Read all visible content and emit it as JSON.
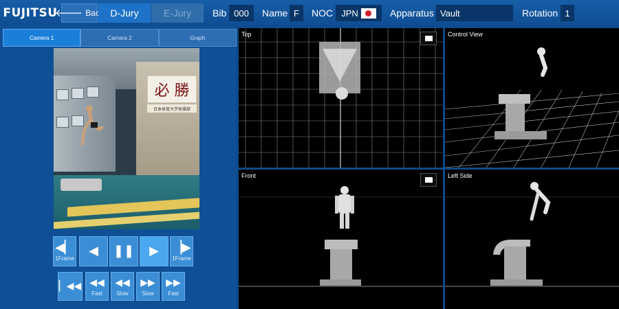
{
  "header": {
    "logo": "FUJITSU",
    "back_label": "Back",
    "d_jury_label": "D-Jury",
    "e_jury_label": "E-Jury",
    "bib_label": "Bib",
    "bib_value": "000",
    "name_label": "Name",
    "name_value": "F",
    "noc_label": "NOC",
    "noc_value": "JPN",
    "apparatus_label": "Apparatus",
    "apparatus_value": "Vault",
    "rotation_label": "Rotation",
    "rotation_value": "1"
  },
  "tabs": [
    {
      "label": "Camera 1",
      "active": true
    },
    {
      "label": "Camera 2",
      "active": false
    },
    {
      "label": "Graph",
      "active": false
    }
  ],
  "video": {
    "banner_text": "必 勝",
    "banner_sub": "日本体育大学体操部"
  },
  "controls": {
    "row1": [
      {
        "name": "prev-frame-button",
        "glyph": "◀▏",
        "sub": "1Frame"
      },
      {
        "name": "reverse-play-button",
        "glyph": "◀",
        "sub": ""
      },
      {
        "name": "pause-button",
        "glyph": "❚❚",
        "sub": ""
      },
      {
        "name": "play-button",
        "glyph": "▶",
        "sub": ""
      },
      {
        "name": "next-frame-button",
        "glyph": "▕▶",
        "sub": "1Frame"
      }
    ],
    "row2": [
      {
        "name": "skip-to-start-button",
        "glyph": "▏◀◀",
        "sub": ""
      },
      {
        "name": "fast-rewind-button",
        "glyph": "◀◀",
        "sub": "Fast"
      },
      {
        "name": "slow-rewind-button",
        "glyph": "◀◀",
        "sub": "Slow"
      },
      {
        "name": "slow-forward-button",
        "glyph": "▶▶",
        "sub": "Slow"
      },
      {
        "name": "fast-forward-button",
        "glyph": "▶▶",
        "sub": "Fast"
      }
    ]
  },
  "views": {
    "top": "Top",
    "control": "Control View",
    "front": "Front",
    "left_side": "Left Side"
  },
  "colors": {
    "accent": "#1b7fd9",
    "background": "#0f4a8a",
    "viewport": "#000000",
    "flag_red": "#d21f2a"
  }
}
